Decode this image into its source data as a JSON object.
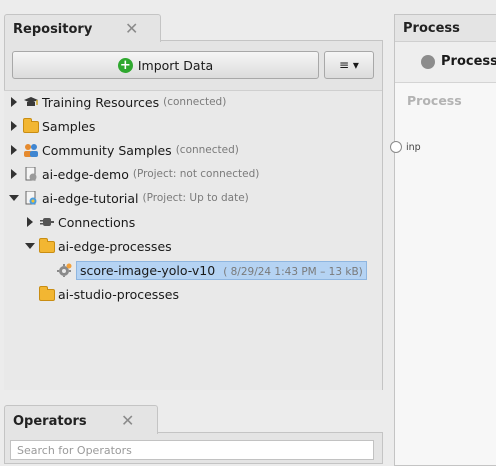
{
  "repository": {
    "tab_title": "Repository",
    "close_glyph": "✕",
    "import_label": "Import Data",
    "menu_glyph": "≡ ▾",
    "tree": [
      {
        "label": "Training Resources",
        "meta": "(connected)",
        "icon": "graduation-cap-icon",
        "expander": "collapsed"
      },
      {
        "label": "Samples",
        "meta": "",
        "icon": "folder-icon",
        "expander": "collapsed"
      },
      {
        "label": "Community Samples",
        "meta": "(connected)",
        "icon": "people-icon",
        "expander": "collapsed"
      },
      {
        "label": "ai-edge-demo",
        "meta": "(Project: not connected)",
        "icon": "project-icon",
        "expander": "collapsed"
      },
      {
        "label": "ai-edge-tutorial",
        "meta": "(Project: Up to date)",
        "icon": "project-icon",
        "expander": "expanded"
      },
      {
        "label": "Connections",
        "meta": "",
        "icon": "connection-plug-icon",
        "expander": "collapsed"
      },
      {
        "label": "ai-edge-processes",
        "meta": "",
        "icon": "folder-open-icon",
        "expander": "expanded"
      },
      {
        "label": "score-image-yolo-v10",
        "meta": "( 8/29/24 1:43 PM – 13 kB)",
        "icon": "process-gear-icon",
        "expander": "none"
      },
      {
        "label": "ai-studio-processes",
        "meta": "",
        "icon": "folder-icon",
        "expander": "none"
      }
    ]
  },
  "process": {
    "tab_title": "Process",
    "toolbar_label": "Process",
    "canvas_label": "Process",
    "port_label": "inp"
  },
  "operators": {
    "tab_title": "Operators",
    "close_glyph": "✕",
    "search_placeholder": "Search for Operators"
  }
}
